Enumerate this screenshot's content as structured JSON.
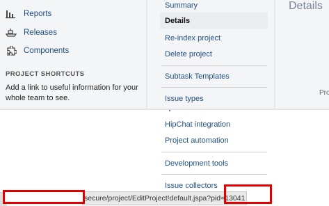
{
  "sidebar": {
    "items": [
      {
        "label": "Reports",
        "icon": "reports-icon"
      },
      {
        "label": "Releases",
        "icon": "releases-icon"
      },
      {
        "label": "Components",
        "icon": "components-icon"
      }
    ],
    "shortcuts_title": "PROJECT SHORTCUTS",
    "shortcuts_text": "Add a link to useful information for your whole team to see."
  },
  "nav": {
    "summary": "Summary",
    "details": "Details",
    "reindex": "Re-index project",
    "delete": "Delete project",
    "subtask_templates": "Subtask Templates",
    "issue_types": "Issue types",
    "hipchat": "HipChat integration",
    "automation": "Project automation",
    "dev_tools": "Development tools",
    "issue_collectors": "Issue collectors"
  },
  "content": {
    "title": "Details",
    "fragment": "Pro"
  },
  "status_bar": {
    "url": "secure/project/EditProject!default.jspa?pid=13041"
  },
  "colors": {
    "link": "#205081",
    "highlight": "#e00000"
  }
}
